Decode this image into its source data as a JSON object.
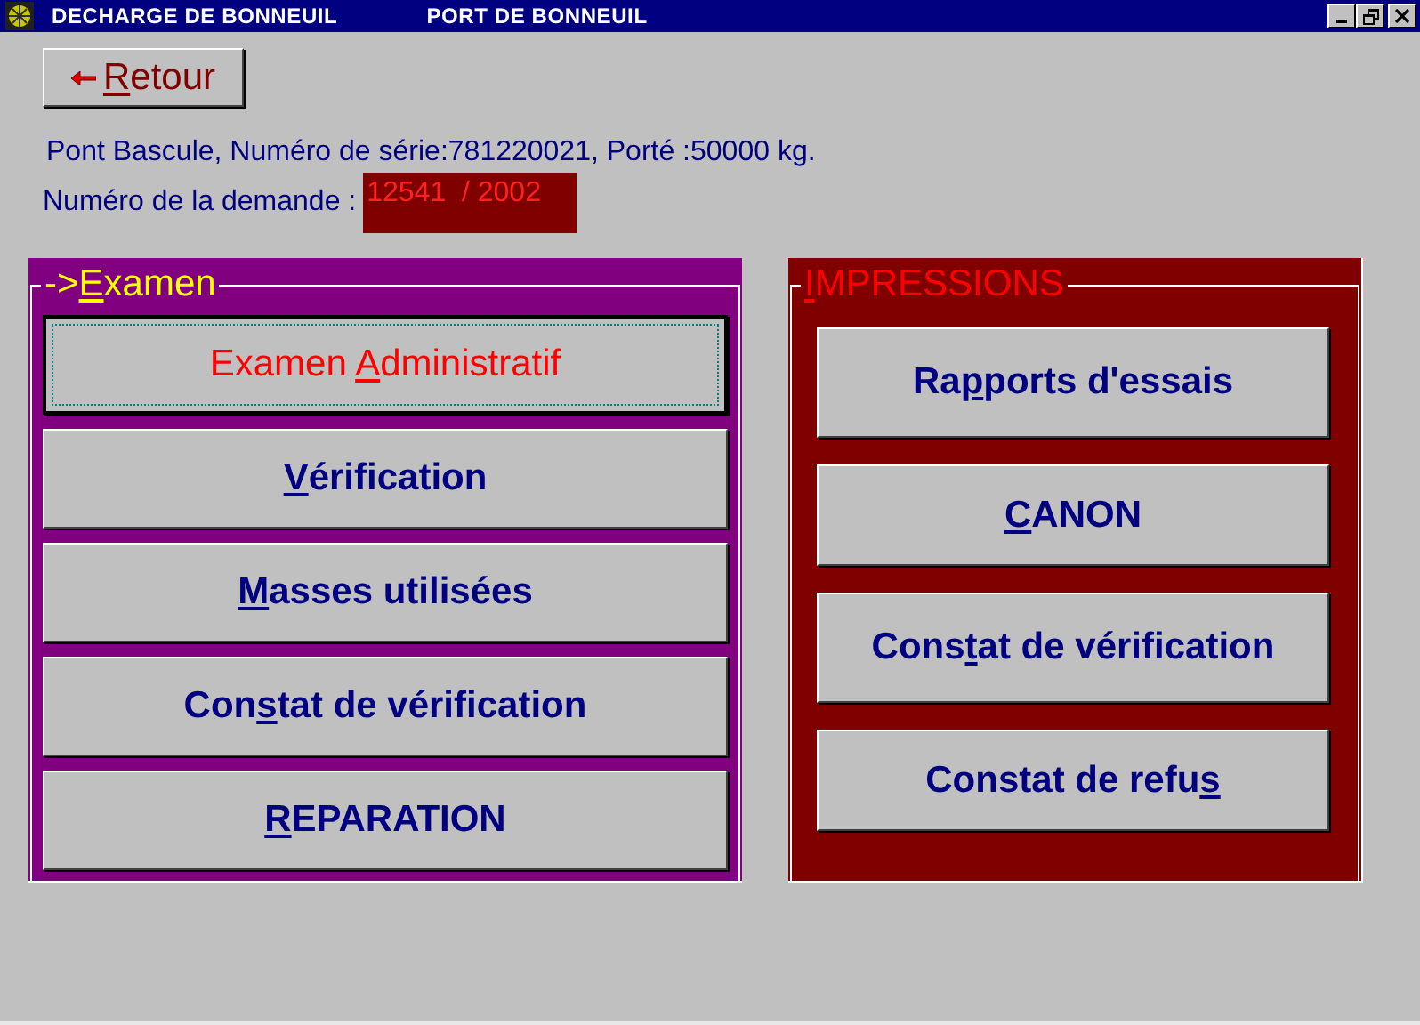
{
  "window": {
    "title": "DECHARGE DE BONNEUIL",
    "subtitle": "PORT DE BONNEUIL"
  },
  "back_button": {
    "key": "R",
    "post": "etour"
  },
  "info": {
    "line": "Pont Bascule, Numéro de série:781220021,  Porté :50000 kg.",
    "request_label": "Numéro de la demande :",
    "request_value": "12541  / 2002"
  },
  "examen": {
    "title_pre": "->",
    "title_key": "E",
    "title_post": "xamen",
    "buttons": [
      {
        "pre": "Examen ",
        "key": "A",
        "post": "dministratif",
        "focused": true
      },
      {
        "key": "V",
        "post": "érification",
        "focused": false
      },
      {
        "key": "M",
        "post": "asses utilisées",
        "focused": false
      },
      {
        "pre": "Con",
        "key": "s",
        "post": "tat de vérification",
        "focused": false
      },
      {
        "key": "R",
        "post": "EPARATION",
        "focused": false
      }
    ]
  },
  "impressions": {
    "title_key": "I",
    "title_post": "MPRESSIONS",
    "buttons": [
      {
        "pre": "Ra",
        "key": "p",
        "post": "ports d'essais",
        "focused": false
      },
      {
        "key": "C",
        "post": "ANON",
        "focused": false
      },
      {
        "pre": "Cons",
        "key": "t",
        "post": "at de vérification",
        "focused": false
      },
      {
        "pre": "Constat de refu",
        "key": "s",
        "focused": false
      }
    ]
  }
}
